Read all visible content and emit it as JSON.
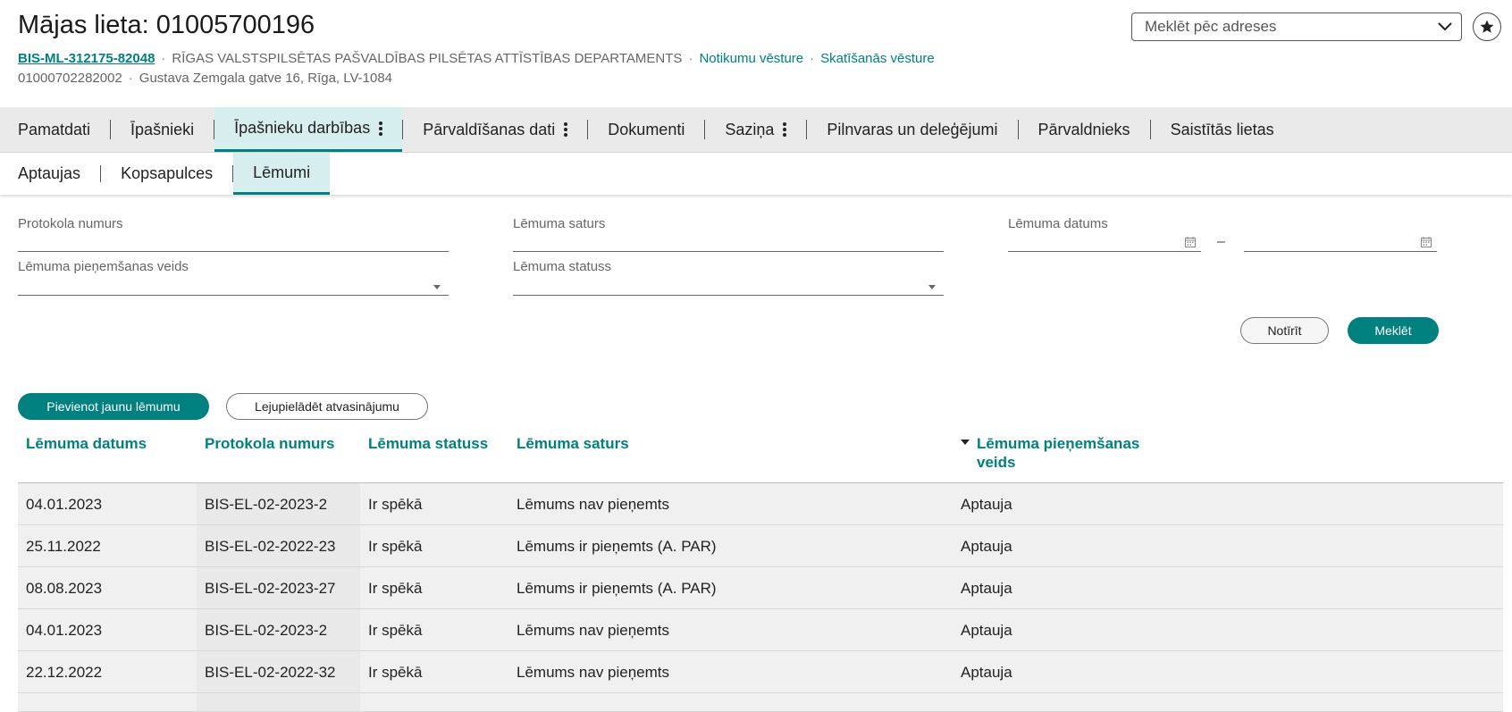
{
  "header": {
    "title": "Mājas lieta: 01005700196",
    "case_id": "BIS-ML-312175-82048",
    "department": "RĪGAS VALSTSPILSĒTAS PAŠVALDĪBAS PILSĒTAS ATTĪSTĪBAS DEPARTAMENTS",
    "event_history_link": "Notikumu vēsture",
    "view_history_link": "Skatīšanās vēsture",
    "separator": "·",
    "cadastral_number": "01000702282002",
    "address": "Gustava Zemgala gatve 16, Rīga, LV-1084"
  },
  "address_search": {
    "placeholder": "Meklēt pēc adreses"
  },
  "tabs": [
    {
      "label": "Pamatdati",
      "active": false,
      "has_menu": false
    },
    {
      "label": "Īpašnieki",
      "active": false,
      "has_menu": false
    },
    {
      "label": "Īpašnieku darbības",
      "active": true,
      "has_menu": true
    },
    {
      "label": "Pārvaldīšanas dati",
      "active": false,
      "has_menu": true
    },
    {
      "label": "Dokumenti",
      "active": false,
      "has_menu": false
    },
    {
      "label": "Saziņa",
      "active": false,
      "has_menu": true
    },
    {
      "label": "Pilnvaras un deleģējumi",
      "active": false,
      "has_menu": false
    },
    {
      "label": "Pārvaldnieks",
      "active": false,
      "has_menu": false
    },
    {
      "label": "Saistītās lietas",
      "active": false,
      "has_menu": false
    }
  ],
  "subtabs": [
    {
      "label": "Aptaujas",
      "active": false
    },
    {
      "label": "Kopsapulces",
      "active": false
    },
    {
      "label": "Lēmumi",
      "active": true
    }
  ],
  "filters": {
    "protocol_number_label": "Protokola numurs",
    "decision_content_label": "Lēmuma saturs",
    "decision_date_label": "Lēmuma datums",
    "date_range_separator": "–",
    "adoption_method_label": "Lēmuma pieņemšanas veids",
    "decision_status_label": "Lēmuma statuss",
    "clear_button": "Notīrīt",
    "search_button": "Meklēt"
  },
  "actions": {
    "add_button": "Pievienot jaunu lēmumu",
    "download_button": "Lejupielādēt atvasinājumu"
  },
  "table": {
    "columns": {
      "date": "Lēmuma datums",
      "protocol": "Protokola numurs",
      "status": "Lēmuma statuss",
      "content": "Lēmuma saturs",
      "method_line1": "Lēmuma pieņemšanas",
      "method_line2": "veids"
    },
    "rows": [
      {
        "date": "04.01.2023",
        "protocol": "BIS-EL-02-2023-2",
        "status": "Ir spēkā",
        "content": "Lēmums nav pieņemts",
        "method": "Aptauja"
      },
      {
        "date": "25.11.2022",
        "protocol": "BIS-EL-02-2022-23",
        "status": "Ir spēkā",
        "content": "Lēmums ir pieņemts (A. PAR)",
        "method": "Aptauja"
      },
      {
        "date": "08.08.2023",
        "protocol": "BIS-EL-02-2023-27",
        "status": "Ir spēkā",
        "content": "Lēmums ir pieņemts (A. PAR)",
        "method": "Aptauja"
      },
      {
        "date": "04.01.2023",
        "protocol": "BIS-EL-02-2023-2",
        "status": "Ir spēkā",
        "content": "Lēmums nav pieņemts",
        "method": "Aptauja"
      },
      {
        "date": "22.12.2022",
        "protocol": "BIS-EL-02-2022-32",
        "status": "Ir spēkā",
        "content": "Lēmums nav pieņemts",
        "method": "Aptauja"
      }
    ]
  },
  "colors": {
    "accent": "#00807f",
    "active_tab_bg": "#d7eeee"
  }
}
